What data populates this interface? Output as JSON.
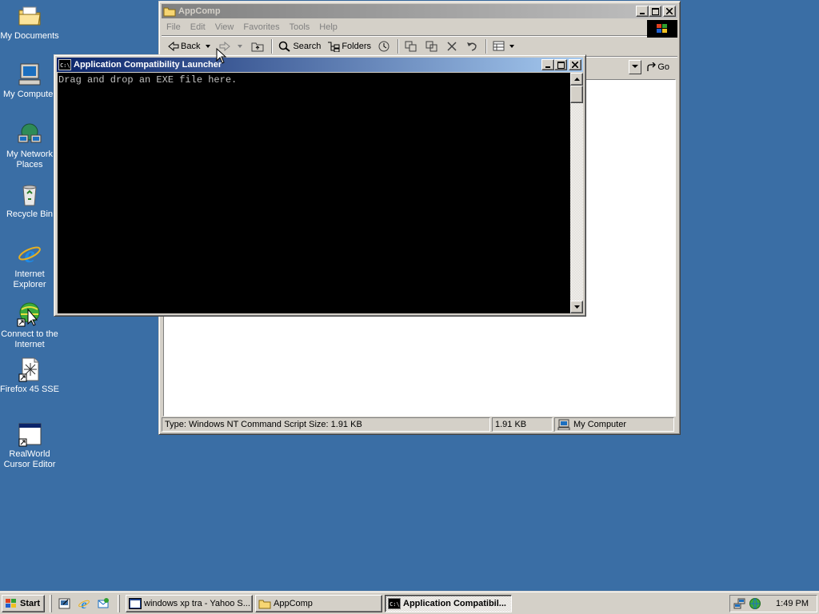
{
  "desktop": {
    "icons": [
      {
        "label": "My Documents",
        "icon": "my-documents-icon"
      },
      {
        "label": "My Computer",
        "icon": "my-computer-icon"
      },
      {
        "label": "My Network Places",
        "icon": "network-places-icon"
      },
      {
        "label": "Recycle Bin",
        "icon": "recycle-bin-icon"
      },
      {
        "label": "Internet Explorer",
        "icon": "internet-explorer-icon"
      },
      {
        "label": "Connect to the Internet",
        "icon": "connect-internet-icon"
      },
      {
        "label": "Firefox 45 SSE",
        "icon": "firefox-shortcut-icon"
      },
      {
        "label": "RealWorld Cursor Editor",
        "icon": "cursor-editor-icon"
      }
    ],
    "background_color": "#3a6ea5"
  },
  "explorer": {
    "title": "AppComp",
    "menu": [
      "File",
      "Edit",
      "View",
      "Favorites",
      "Tools",
      "Help"
    ],
    "toolbar": {
      "back": "Back",
      "search": "Search",
      "folders": "Folders"
    },
    "go": "Go",
    "status": {
      "type_info": "Type: Windows NT Command Script Size: 1.91 KB",
      "size": "1.91 KB",
      "zone": "My Computer"
    }
  },
  "console": {
    "title": "Application Compatibility Launcher",
    "text": "Drag and drop an EXE file here."
  },
  "taskbar": {
    "start": "Start",
    "tasks": [
      {
        "label": "windows xp tra - Yahoo S...",
        "active": false
      },
      {
        "label": "AppComp",
        "active": false
      },
      {
        "label": "Application Compatibil...",
        "active": true
      }
    ],
    "clock": "1:49 PM"
  },
  "colors": {
    "active_title_start": "#0a246a",
    "active_title_end": "#a6caf0",
    "inactive_title": "#808080",
    "face": "#d4d0c8"
  }
}
